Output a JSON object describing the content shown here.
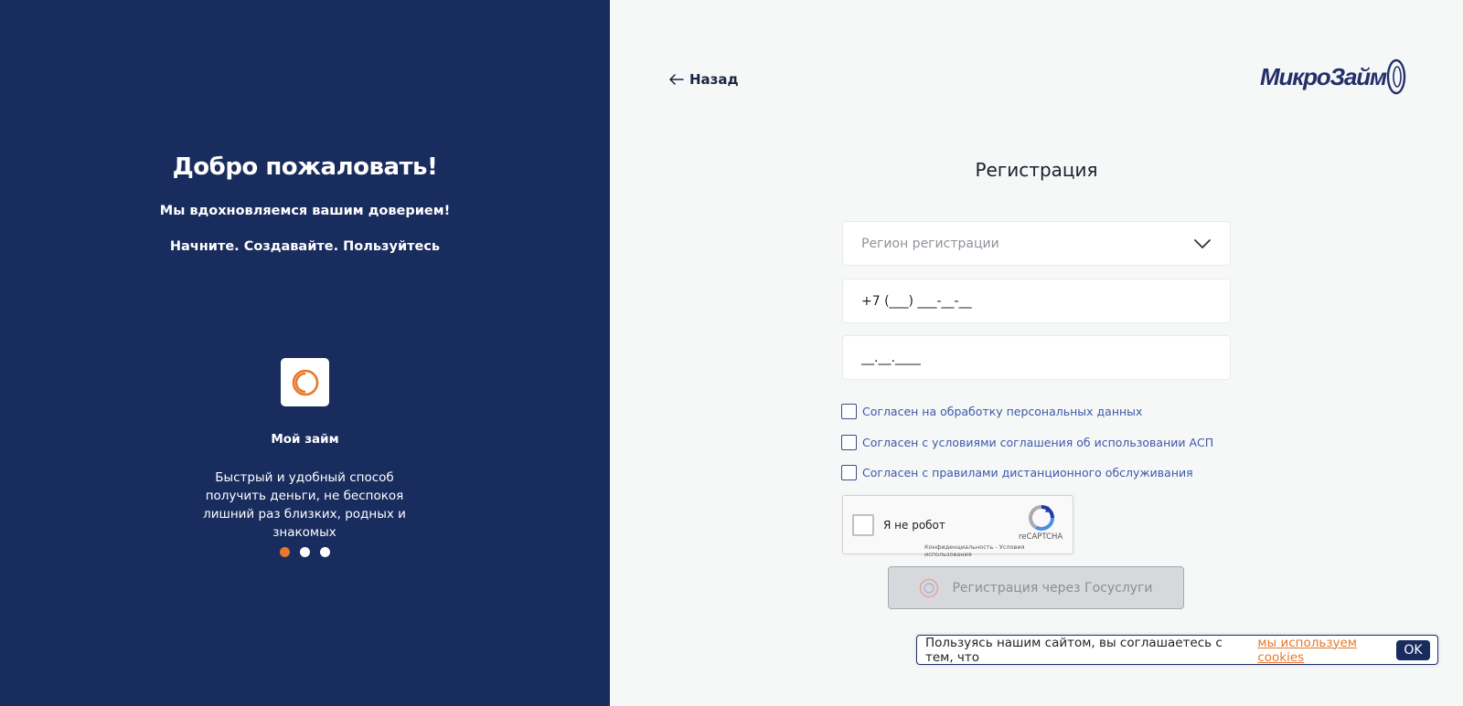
{
  "left": {
    "welcome": "Добро пожаловать!",
    "subtitle1": "Мы вдохновляемся вашим доверием!",
    "subtitle2": "Начните. Создавайте. Пользуйтесь",
    "slide": {
      "icon": "coin-ring-icon",
      "name": "Мой займ",
      "description": "Быстрый и удобный способ получить деньги, не беспокоя лишний раз близких, родных и знакомых"
    },
    "dots": [
      true,
      false,
      false
    ]
  },
  "header": {
    "back_label": "Назад",
    "logo": "МикроЗайм"
  },
  "form": {
    "title": "Регистрация",
    "region_placeholder": "Регион регистрации",
    "phone_value": "+7 (___) ___-__-__",
    "date_value": "__.__.____",
    "checkboxes": [
      "Согласен на обработку персональных данных",
      "Согласен с условиями соглашения об использовании АСП",
      "Согласен с правилами дистанционного обслуживания"
    ],
    "captcha": {
      "label": "Я не робот",
      "brand": "reCAPTCHA",
      "links": "Конфиденциальность - Условия использования"
    },
    "gosuslugi_button": "Регистрация через Госуслуги"
  },
  "cookie": {
    "text": "Пользуясь нашим сайтом, вы соглашаетесь с тем, что",
    "link": "мы используем cookies",
    "ok": "OK"
  },
  "colors": {
    "navy": "#192c5e",
    "accent": "#e8782a",
    "link_blue": "#3e58a8"
  }
}
